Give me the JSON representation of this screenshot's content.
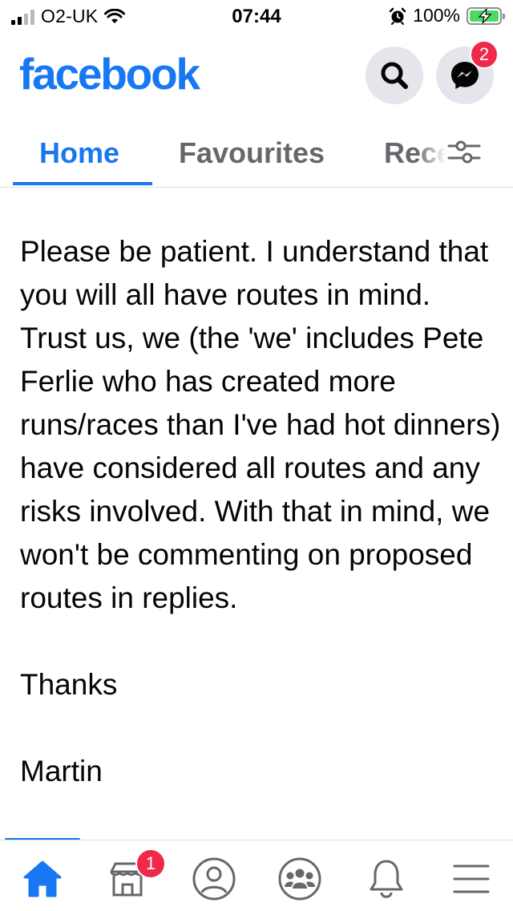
{
  "status_bar": {
    "carrier": "O2-UK",
    "time": "07:44",
    "battery": "100%"
  },
  "header": {
    "logo": "facebook",
    "messenger_badge": "2"
  },
  "tabs": [
    {
      "label": "Home",
      "active": true
    },
    {
      "label": "Favourites",
      "active": false
    },
    {
      "label": "Recent",
      "active": false
    }
  ],
  "post": {
    "body": "Please be patient.  I understand that you will all have routes in mind. Trust us, we (the 'we' includes Pete Ferlie who has created more runs/races than I've had hot dinners) have considered all routes and any risks involved. With that in mind, we won't be commenting on proposed routes in replies.",
    "thanks": "Thanks",
    "signature": "Martin"
  },
  "bottom_nav": {
    "items": [
      "home-icon",
      "marketplace-icon",
      "profile-icon",
      "groups-icon",
      "notifications-icon",
      "menu-icon"
    ],
    "marketplace_badge": "1"
  },
  "colors": {
    "brand": "#1877f2",
    "badge": "#f02849",
    "muted": "#65676b"
  }
}
